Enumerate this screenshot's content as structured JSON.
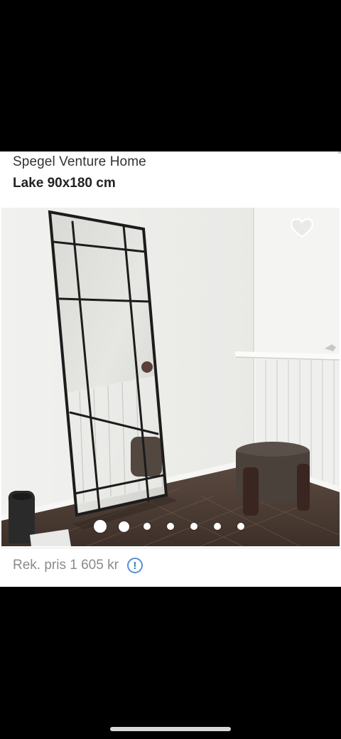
{
  "product": {
    "brand": "Spegel Venture Home",
    "model": "Lake 90x180 cm",
    "price_label": "Rek. pris 1 605 kr",
    "info_glyph": "!"
  },
  "gallery": {
    "image_count": 7,
    "active_index": 0,
    "favorite_icon": "heart-outline-icon"
  },
  "colors": {
    "accent": "#3b78c4",
    "price_text": "#8a8a8a",
    "background": "#000000"
  }
}
